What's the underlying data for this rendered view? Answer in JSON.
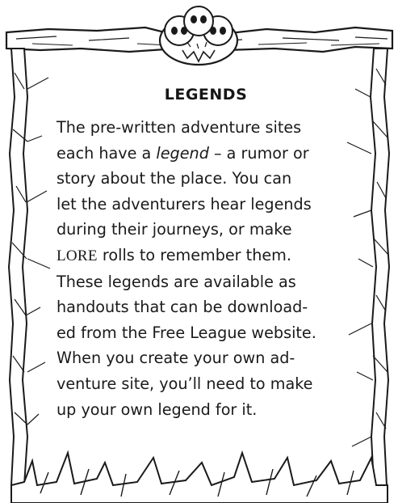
{
  "sidebar_box": {
    "heading": "LEGENDS",
    "lines": [
      {
        "text": "The pre-written adventure sites"
      },
      {
        "pre": "each have a ",
        "em": "legend",
        "post": " – a rumor or"
      },
      {
        "text": "story about the place. You can"
      },
      {
        "text": "let the adventurers hear legends"
      },
      {
        "text": "during their journeys, or make"
      },
      {
        "sc": "LORE",
        "post": " rolls to remember them."
      },
      {
        "text": "These legends are available as"
      },
      {
        "text": "handouts that can be download-"
      },
      {
        "text": "ed from the Free League website."
      },
      {
        "text": "When you create your own ad-"
      },
      {
        "text": "venture site, you’ll need to make"
      },
      {
        "text": "up your own legend for it."
      }
    ]
  },
  "decoration": {
    "top_ornament_icon": "skull-pile-icon",
    "frame_style": "cracked-stone-border",
    "ink_color": "#1a1a1a",
    "background_color": "#ffffff"
  }
}
